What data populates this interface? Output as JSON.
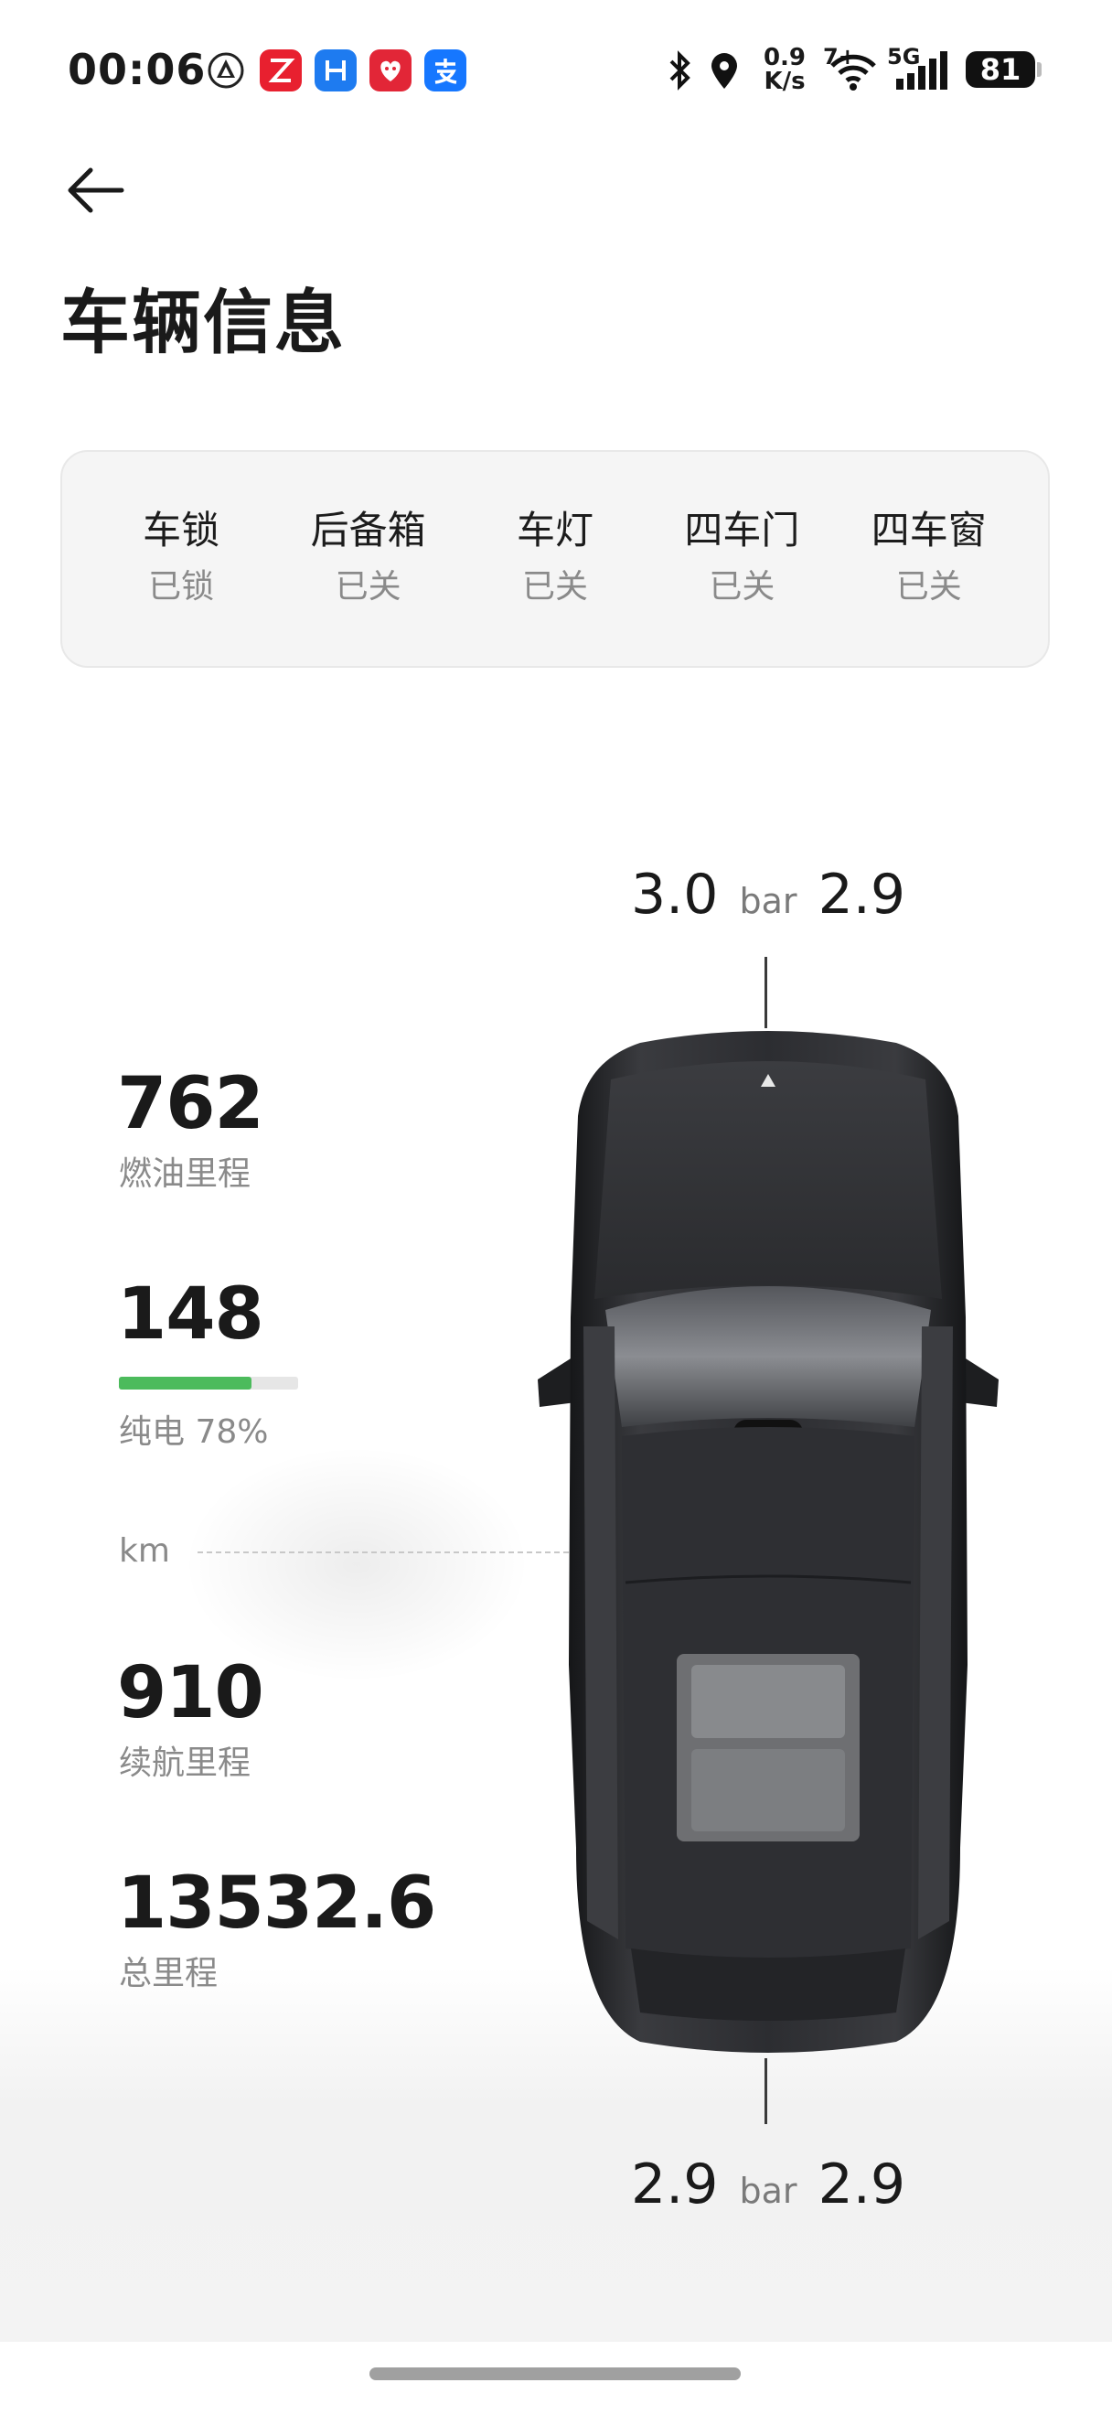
{
  "status_bar": {
    "time": "00:06",
    "net_speed_value": "0.9",
    "net_speed_unit": "K/s",
    "wifi_label": "7+",
    "cellular_label": "5G",
    "battery": "81"
  },
  "header": {
    "title": "车辆信息"
  },
  "vehicle_status": [
    {
      "label": "车锁",
      "value": "已锁"
    },
    {
      "label": "后备箱",
      "value": "已关"
    },
    {
      "label": "车灯",
      "value": "已关"
    },
    {
      "label": "四车门",
      "value": "已关"
    },
    {
      "label": "四车窗",
      "value": "已关"
    }
  ],
  "tire_pressure": {
    "unit": "bar",
    "front_left": "3.0",
    "front_right": "2.9",
    "rear_left": "2.9",
    "rear_right": "2.9"
  },
  "stats": {
    "fuel_range": {
      "value": "762",
      "label": "燃油里程"
    },
    "ev_range": {
      "value": "148",
      "label": "纯电 78%",
      "battery_fraction": 0.78
    },
    "unit": "km",
    "total_range": {
      "value": "910",
      "label": "续航里程"
    },
    "odometer": {
      "value": "13532.6",
      "label": "总里程"
    }
  },
  "colors": {
    "ev_bar": "#4cbb5c",
    "car_body": "#2a2b2e",
    "app_red": "#e8202f",
    "app_blue": "#1e7bf0"
  },
  "icons": [
    "bluetooth-icon",
    "location-icon",
    "wifi-icon",
    "signal-icon",
    "back-arrow-icon"
  ]
}
